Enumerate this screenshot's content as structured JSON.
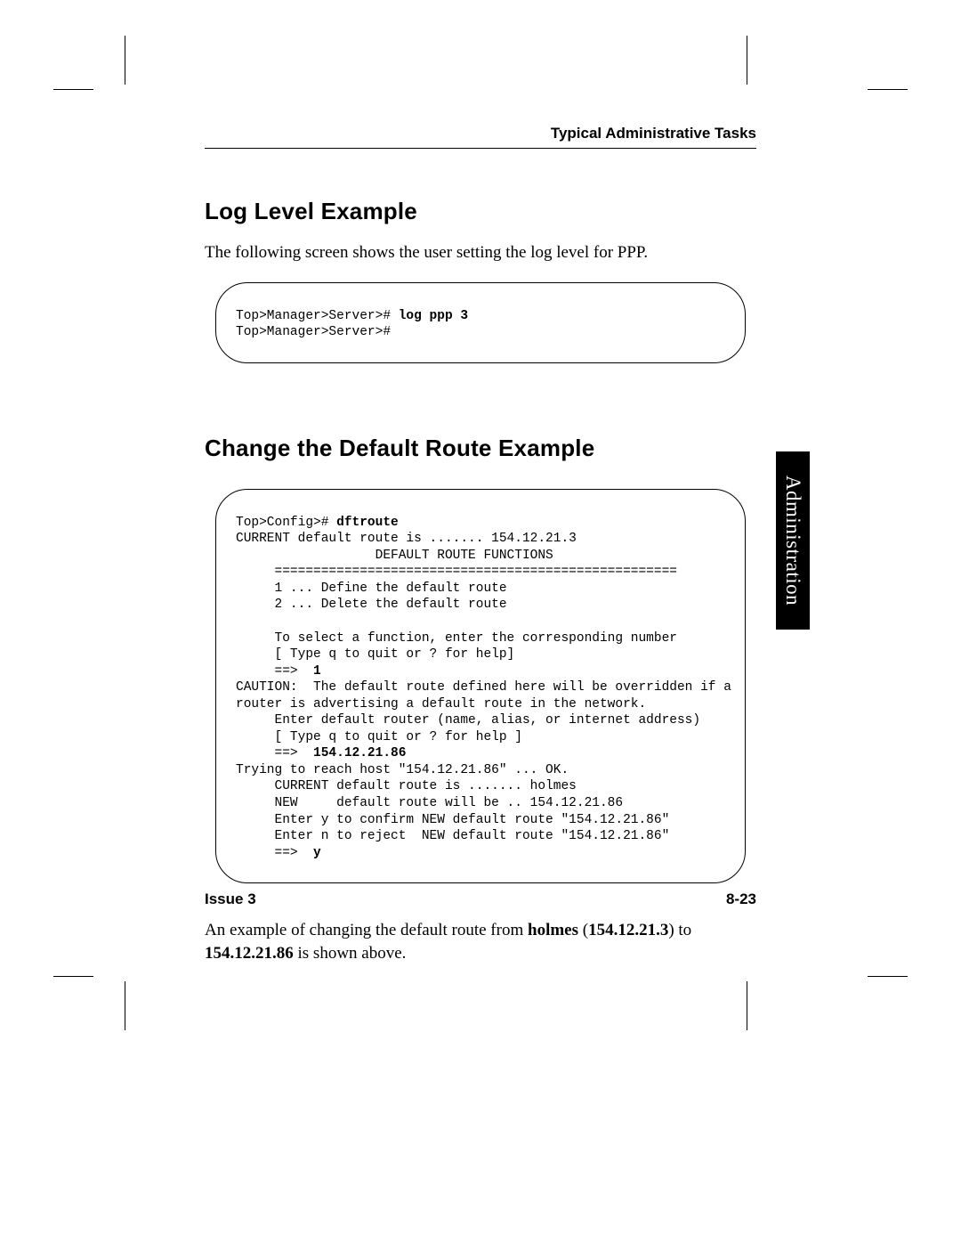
{
  "header": {
    "running": "Typical Administrative Tasks"
  },
  "sideTab": "Administration",
  "section1": {
    "heading": "Log Level Example",
    "intro": "The following screen shows the user setting the log level for PPP.",
    "term": {
      "l1a": "Top>Manager>Server># ",
      "l1b": "log ppp 3",
      "l2": "Top>Manager>Server>#"
    }
  },
  "section2": {
    "heading": "Change the Default Route Example",
    "term": {
      "l01a": "Top>Config># ",
      "l01b": "dftroute",
      "l02": "CURRENT default route is ....... 154.12.21.3",
      "l03": "                  DEFAULT ROUTE FUNCTIONS",
      "l04": "     ====================================================",
      "l05": "     1 ... Define the default route",
      "l06": "     2 ... Delete the default route",
      "l07": "",
      "l08": "     To select a function, enter the corresponding number",
      "l09": "     [ Type q to quit or ? for help]",
      "l10a": "     ==>  ",
      "l10b": "1",
      "l11": "CAUTION:  The default route defined here will be overridden if a",
      "l12": "router is advertising a default route in the network.",
      "l13": "     Enter default router (name, alias, or internet address)",
      "l14": "     [ Type q to quit or ? for help ]",
      "l15a": "     ==>  ",
      "l15b": "154.12.21.86",
      "l16": "Trying to reach host \"154.12.21.86\" ... OK.",
      "l17": "     CURRENT default route is ....... holmes",
      "l18": "     NEW     default route will be .. 154.12.21.86",
      "l19": "     Enter y to confirm NEW default route \"154.12.21.86\"",
      "l20": "     Enter n to reject  NEW default route \"154.12.21.86\"",
      "l21a": "     ==>  ",
      "l21b": "y"
    },
    "outro": {
      "t1": "An example of changing the default route from ",
      "b1": "holmes",
      "t2": " (",
      "b2": "154.12.21.3",
      "t3": ") to ",
      "b3": "154.12.21.86",
      "t4": " is shown above."
    }
  },
  "footer": {
    "left": "Issue 3",
    "right": "8-23"
  }
}
